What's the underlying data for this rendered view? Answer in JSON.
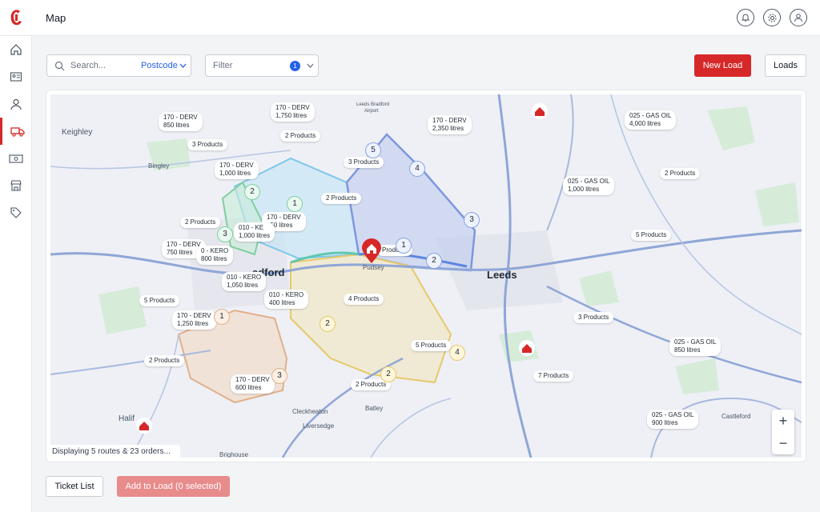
{
  "header": {
    "title": "Map"
  },
  "sidebar": {
    "items": [
      {
        "name": "home-icon"
      },
      {
        "name": "contact-card-icon"
      },
      {
        "name": "user-icon"
      },
      {
        "name": "truck-icon",
        "active": true
      },
      {
        "name": "money-icon"
      },
      {
        "name": "store-icon"
      },
      {
        "name": "tag-icon"
      }
    ]
  },
  "toolbar": {
    "search_placeholder": "Search...",
    "postcode_label": "Postcode",
    "filter_placeholder": "Filter",
    "filter_count": "1",
    "new_load_label": "New Load",
    "loads_label": "Loads"
  },
  "map": {
    "towns": {
      "keighley": "Keighley",
      "bingley": "Bingley",
      "bradford": "adford",
      "pudsey": "Pudsey",
      "leeds": "Leeds",
      "cleckheaton": "Cleckheaton",
      "batley": "Batley",
      "liversedge": "Liversedge",
      "brighouse": "Brighouse",
      "halifax": "Halif",
      "castleford": "Castleford",
      "airport1": "Leeds Bradford",
      "airport2": "Airport"
    },
    "labels": [
      "170 - DERV",
      "850 litres",
      "170 - DERV",
      "1,750 litres",
      "170 - DERV",
      "2,350 litres",
      "025 - GAS OIL",
      "4,000 litres",
      "3 Products",
      "2 Products",
      "170 - DERV",
      "1,000 litres",
      "3 Products",
      "025 - GAS OIL",
      "1,000 litres",
      "2 Products",
      "2 Products",
      "2 Products",
      "170 - DERV",
      "850 litres",
      "010 - KE",
      "1,000 litres",
      "170 - DERV",
      "750 litres",
      "0 - KERO",
      "800 litres",
      "5 Products",
      "Products",
      "010 - KERO",
      "1,050 litres",
      "010 - KERO",
      "400 litres",
      "4 Products",
      "5 Products",
      "170 - DERV",
      "1,250 litres",
      "3 Products",
      "5 Products",
      "025 - GAS OIL",
      "850 litres",
      "2 Products",
      "7 Products",
      "170 - DERV",
      "600 litres",
      "2 Products",
      "025 - GAS OIL",
      "900 litres"
    ],
    "pins": [
      "5",
      "4",
      "2",
      "1",
      "3",
      "1",
      "2",
      "3",
      "1",
      "2",
      "3",
      "4",
      "2"
    ],
    "status": "Displaying 5 routes & 23 orders...",
    "zoom_in": "+",
    "zoom_out": "−"
  },
  "footer": {
    "ticket_list_label": "Ticket List",
    "add_to_load_label": "Add to Load (0 selected)"
  },
  "colors": {
    "brand": "#d62828",
    "accent": "#2563eb"
  }
}
